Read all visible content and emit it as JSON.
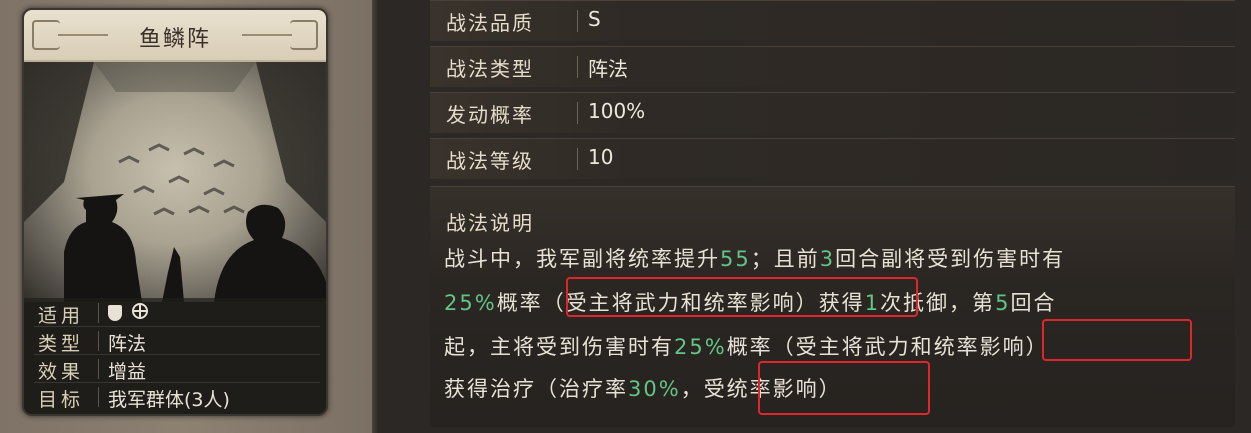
{
  "card": {
    "name": "鱼鳞阵",
    "rows": [
      {
        "key": "适用",
        "value": "",
        "icons": [
          "shield-icon",
          "chariot-wheel-icon"
        ]
      },
      {
        "key": "类型",
        "value": "阵法"
      },
      {
        "key": "效果",
        "value": "增益"
      },
      {
        "key": "目标",
        "value": "我军群体(3人)"
      }
    ]
  },
  "details": {
    "quality_label": "战法品质",
    "quality_value": "S",
    "type_label": "战法类型",
    "type_value": "阵法",
    "rate_label": "发动概率",
    "rate_value": "100%",
    "level_label": "战法等级",
    "level_value": "10"
  },
  "description": {
    "title": "战法说明",
    "line1_a": "战斗中，我军副将统率提升",
    "line1_n1": "55",
    "line1_b": "；且前",
    "line1_n2": "3",
    "line1_c": "回合副将受到伤害时有",
    "line2_n1": "25%",
    "line2_a": "概率",
    "line2_box": "（受主将武力和统率影响）",
    "line2_b": "获得",
    "line2_n2": "1",
    "line2_c": "次抵御，第",
    "line2_n3": "5",
    "line2_d": "回合",
    "line3_a": "起，主将受到伤害时有",
    "line3_n1": "25%",
    "line3_b": "概率（受主将武力和",
    "line3_box": "统率影响）",
    "line4_a": "获得治疗（治疗率",
    "line4_n1": "30%",
    "line4_b": "，",
    "line4_box": "受统率影响）"
  },
  "colors": {
    "highlight_number": "#62c485",
    "annotation_box": "#e0262a"
  }
}
